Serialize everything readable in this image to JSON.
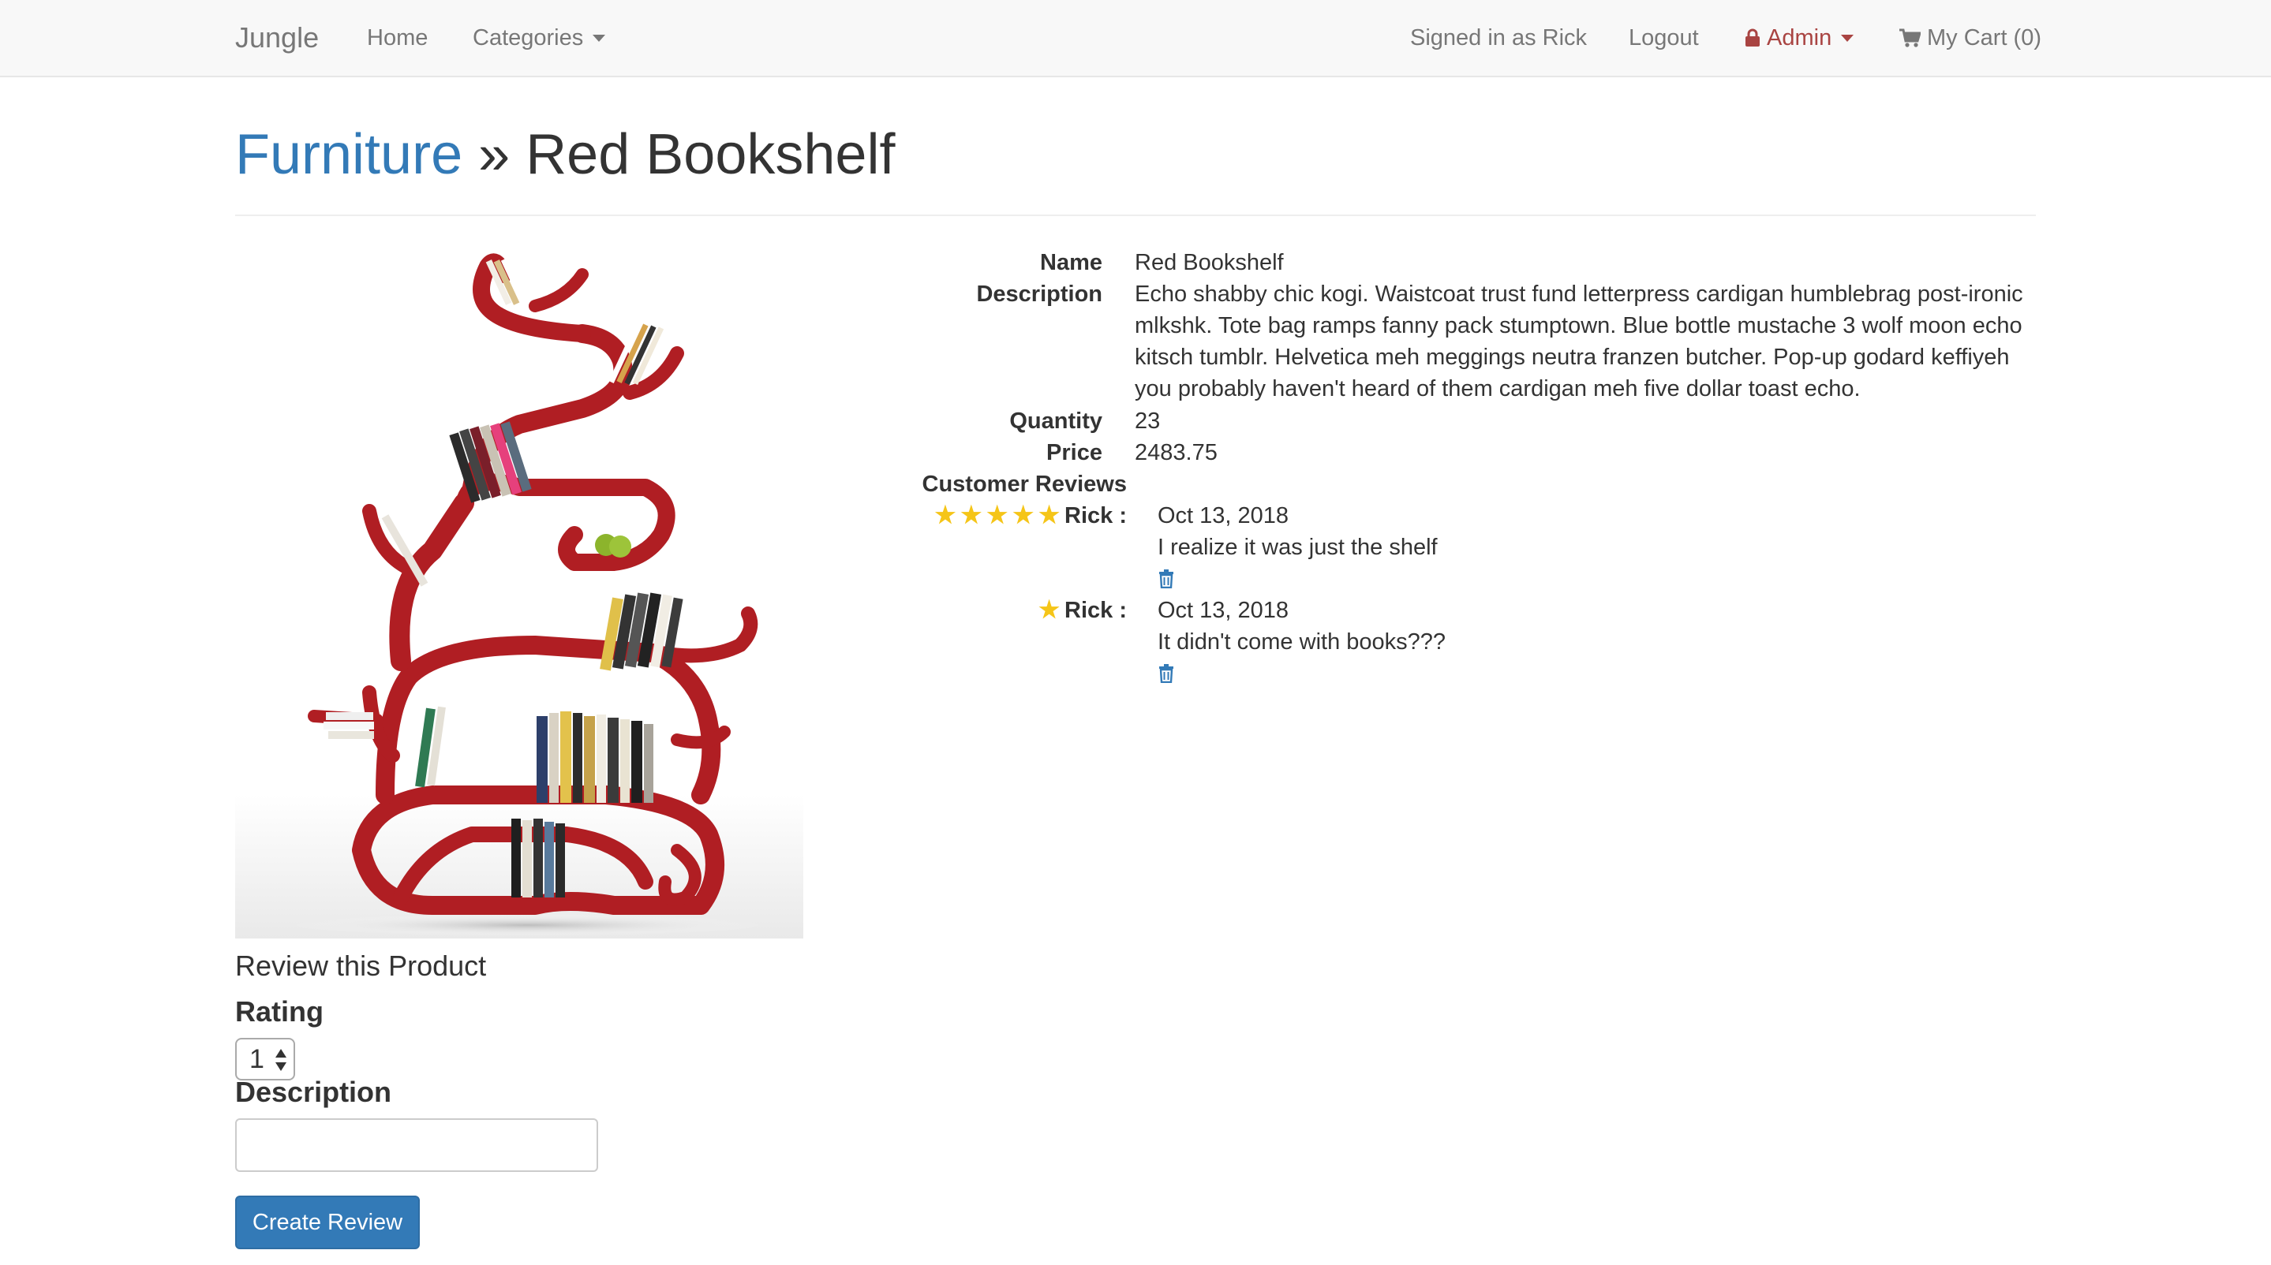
{
  "navbar": {
    "brand": "Jungle",
    "home": "Home",
    "categories": "Categories",
    "signed_in": "Signed in as Rick",
    "logout": "Logout",
    "admin": "Admin",
    "cart": "My Cart (0)"
  },
  "header": {
    "category": "Furniture",
    "separator": "»",
    "product": "Red Bookshelf"
  },
  "details": {
    "name_label": "Name",
    "name_value": "Red Bookshelf",
    "description_label": "Description",
    "description_value": "Echo shabby chic kogi. Waistcoat trust fund letterpress cardigan humblebrag post-ironic mlkshk. Tote bag ramps fanny pack stumptown. Blue bottle mustache 3 wolf moon echo kitsch tumblr. Helvetica meh meggings neutra franzen butcher. Pop-up godard keffiyeh you probably haven't heard of them cardigan meh five dollar toast echo.",
    "quantity_label": "Quantity",
    "quantity_value": "23",
    "price_label": "Price",
    "price_value": "2483.75",
    "reviews_label": "Customer Reviews"
  },
  "reviews": [
    {
      "rating": 5,
      "author": "Rick :",
      "date": "Oct 13, 2018",
      "text": "I realize it was just the shelf"
    },
    {
      "rating": 1,
      "author": "Rick :",
      "date": "Oct 13, 2018",
      "text": "It didn't come with books???"
    }
  ],
  "review_form": {
    "heading": "Review this Product",
    "rating_label": "Rating",
    "rating_value": "1",
    "description_label": "Description",
    "description_value": "",
    "submit": "Create Review"
  },
  "colors": {
    "link": "#337ab7",
    "admin": "#a94442",
    "star": "#f5c518",
    "shelf_red": "#b01e23"
  }
}
